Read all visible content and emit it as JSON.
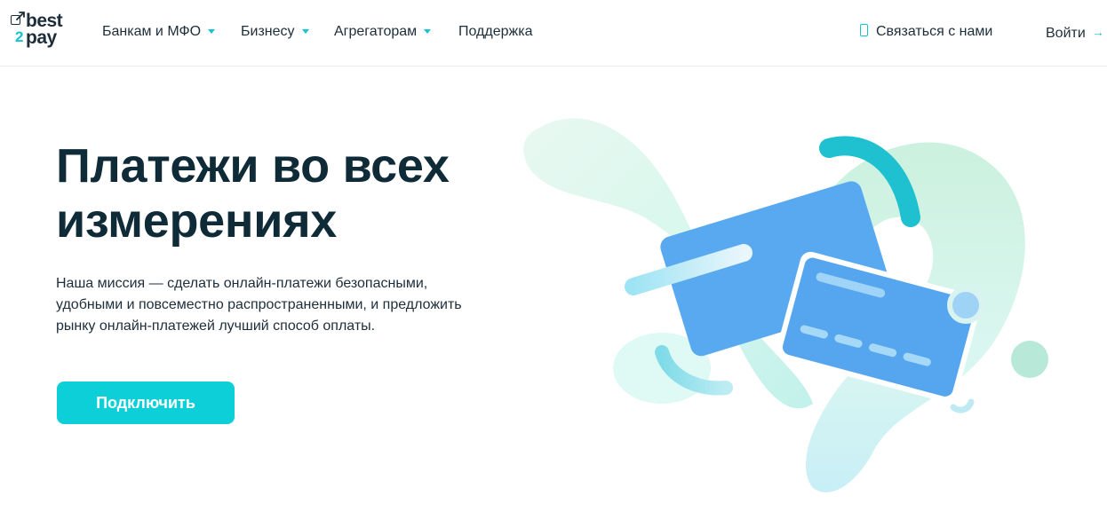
{
  "header": {
    "logo": {
      "word_top": "best",
      "digit": "2",
      "word_bottom": "pay"
    },
    "nav": [
      {
        "label": "Банкам и МФО",
        "dropdown": true
      },
      {
        "label": "Бизнесу",
        "dropdown": true
      },
      {
        "label": "Агрегаторам",
        "dropdown": true
      },
      {
        "label": "Поддержка",
        "dropdown": false
      }
    ],
    "contact_label": "Связаться с нами",
    "login_label": "Войти",
    "accent_color": "#14c4d4"
  },
  "hero": {
    "title_lines": [
      "Платежи во всех",
      "измерениях"
    ],
    "description_lines": [
      "Наша миссия — сделать онлайн-платежи безопасными,",
      "удобными и повсеместно распространенными, и предложить",
      "рынку онлайн-платежей лучший способ оплаты."
    ],
    "button_label": "Подключить",
    "button_color": "#0ccfd8"
  },
  "illustration": {
    "icons": [
      "credit-card-icon",
      "credit-card-icon",
      "signal-arc-icon"
    ],
    "card_color": "#55a8f0",
    "blob_color": "#c8f2e4"
  }
}
